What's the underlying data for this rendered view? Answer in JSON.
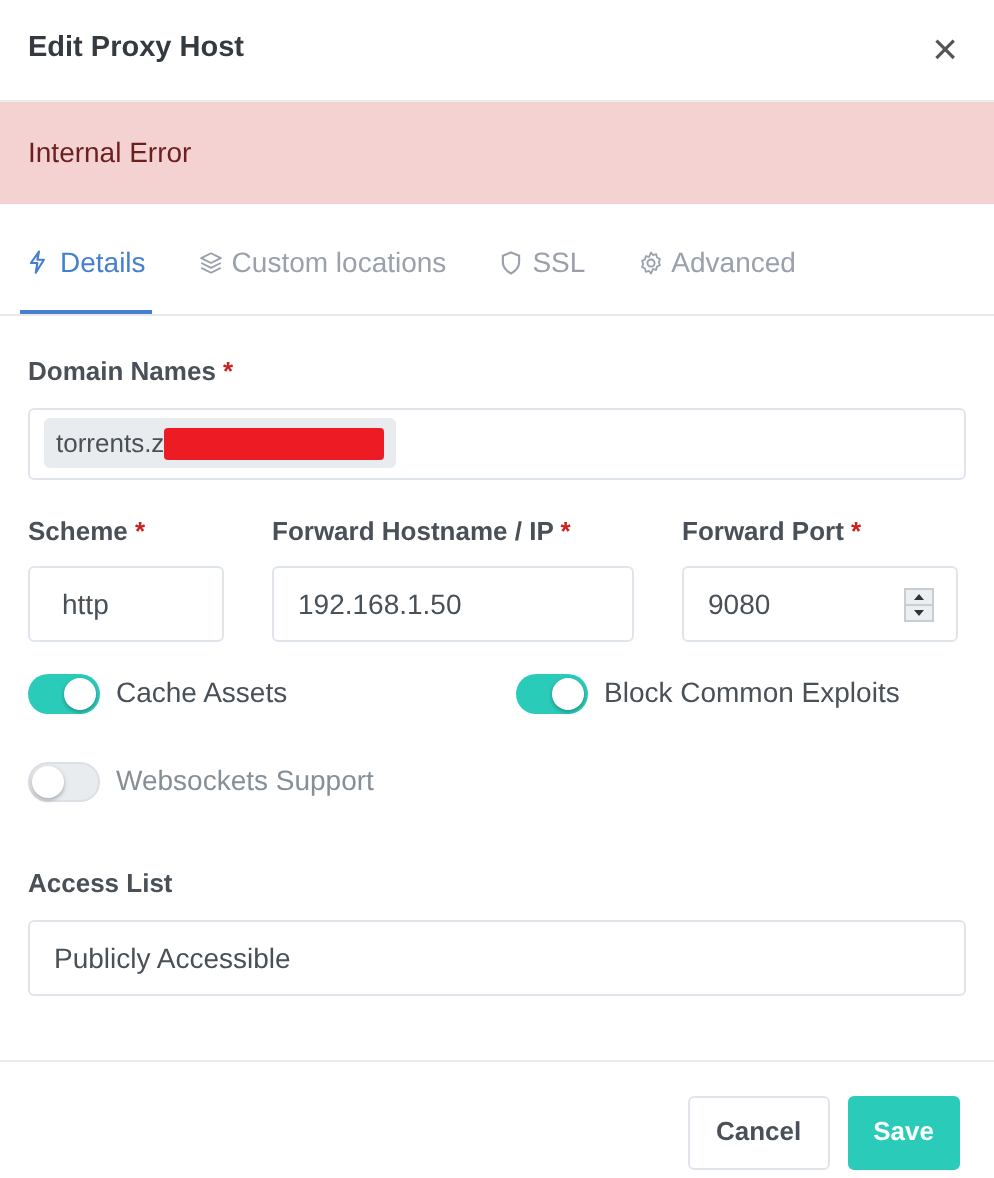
{
  "modal": {
    "title": "Edit Proxy Host",
    "close": "×"
  },
  "alert": {
    "text": "Internal Error"
  },
  "tabs": [
    {
      "label": "Details",
      "selected": true
    },
    {
      "label": "Custom locations",
      "selected": false
    },
    {
      "label": "SSL",
      "selected": false
    },
    {
      "label": "Advanced",
      "selected": false
    }
  ],
  "domain_names": {
    "label": "Domain Names",
    "required_mark": "*",
    "tags": [
      {
        "text": "torrents.z",
        "redacted": true
      }
    ]
  },
  "fields": [
    {
      "label": "Scheme",
      "required_mark": "*",
      "value": "http",
      "kind": "text"
    },
    {
      "label": "Forward Hostname / IP",
      "required_mark": "*",
      "value": "192.168.1.50",
      "kind": "text"
    },
    {
      "label": "Forward Port",
      "required_mark": "*",
      "value": "9080",
      "kind": "number"
    }
  ],
  "toggles": [
    {
      "label": "Cache Assets",
      "on": true
    },
    {
      "label": "Block Common Exploits",
      "on": true
    },
    {
      "label": "Websockets Support",
      "on": false
    }
  ],
  "access_list": {
    "label": "Access List",
    "value": "Publicly Accessible"
  },
  "buttons": [
    {
      "label": "Cancel",
      "kind": "secondary"
    },
    {
      "label": "Save",
      "kind": "primary"
    }
  ]
}
